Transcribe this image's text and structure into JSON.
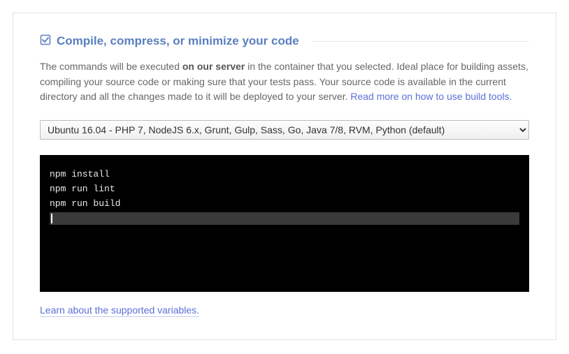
{
  "section": {
    "title": "Compile, compress, or minimize your code",
    "description_prefix": "The commands will be executed ",
    "description_bold": "on our server",
    "description_suffix": " in the container that you selected. Ideal place for building assets, compiling your source code or making sure that your tests pass. Your source code is available in the current directory and all the changes made to it will be deployed to your server. ",
    "description_link": "Read more on how to use build tools."
  },
  "container_select": {
    "selected": "Ubuntu 16.04 - PHP 7, NodeJS 6.x, Grunt, Gulp, Sass, Go, Java 7/8, RVM, Python (default)"
  },
  "terminal": {
    "lines": [
      "npm install",
      "npm run lint",
      "npm run build"
    ]
  },
  "footer": {
    "variables_link": "Learn about the supported variables."
  },
  "icons": {
    "check": "check-icon"
  }
}
